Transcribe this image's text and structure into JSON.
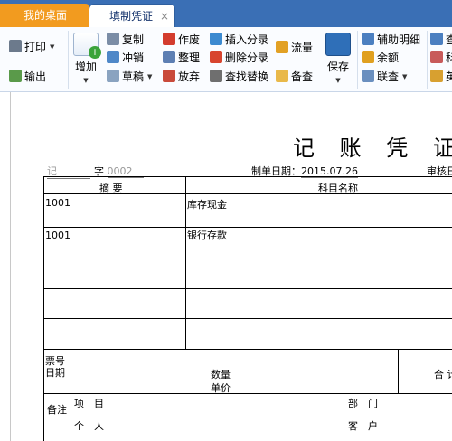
{
  "tabs": [
    {
      "label": "我的桌面"
    },
    {
      "label": "填制凭证"
    }
  ],
  "tab_close": "×",
  "ribbon": {
    "print": "打印",
    "export": "输出",
    "add": "增加",
    "copy": "复制",
    "reverse": "冲销",
    "draft": "草稿",
    "void": "作废",
    "organize": "整理",
    "discard": "放弃",
    "insert_entry": "插入分录",
    "delete_entry": "删除分录",
    "find_replace": "查找替换",
    "flow": "流量",
    "note": "备查",
    "save": "保存",
    "aux_detail": "辅助明细",
    "balance": "余额",
    "link_query": "联查",
    "col4_row1": "查",
    "col4_row2": "科",
    "col4_row3": "英"
  },
  "voucher": {
    "title": "记 账 凭 证",
    "type_value": "记",
    "type_label": "字",
    "number": "0002",
    "date_label": "制单日期：",
    "date_value": "2015.07.26",
    "audit_label": "审核日",
    "headers": {
      "summary": "摘 要",
      "account": "科目名称"
    },
    "rows": [
      {
        "summary": "1001",
        "account": "库存现金"
      },
      {
        "summary": "1001",
        "account": "银行存款"
      },
      {
        "summary": "",
        "account": ""
      },
      {
        "summary": "",
        "account": ""
      },
      {
        "summary": "",
        "account": ""
      }
    ],
    "footer": {
      "ticket_no": "票号",
      "date": "日期",
      "quantity": "数量",
      "unit_price": "单价",
      "total": "合 计",
      "remark": "备注",
      "project": "项　目",
      "department": "部　门",
      "personal": "个　人",
      "customer": "客　户"
    }
  }
}
